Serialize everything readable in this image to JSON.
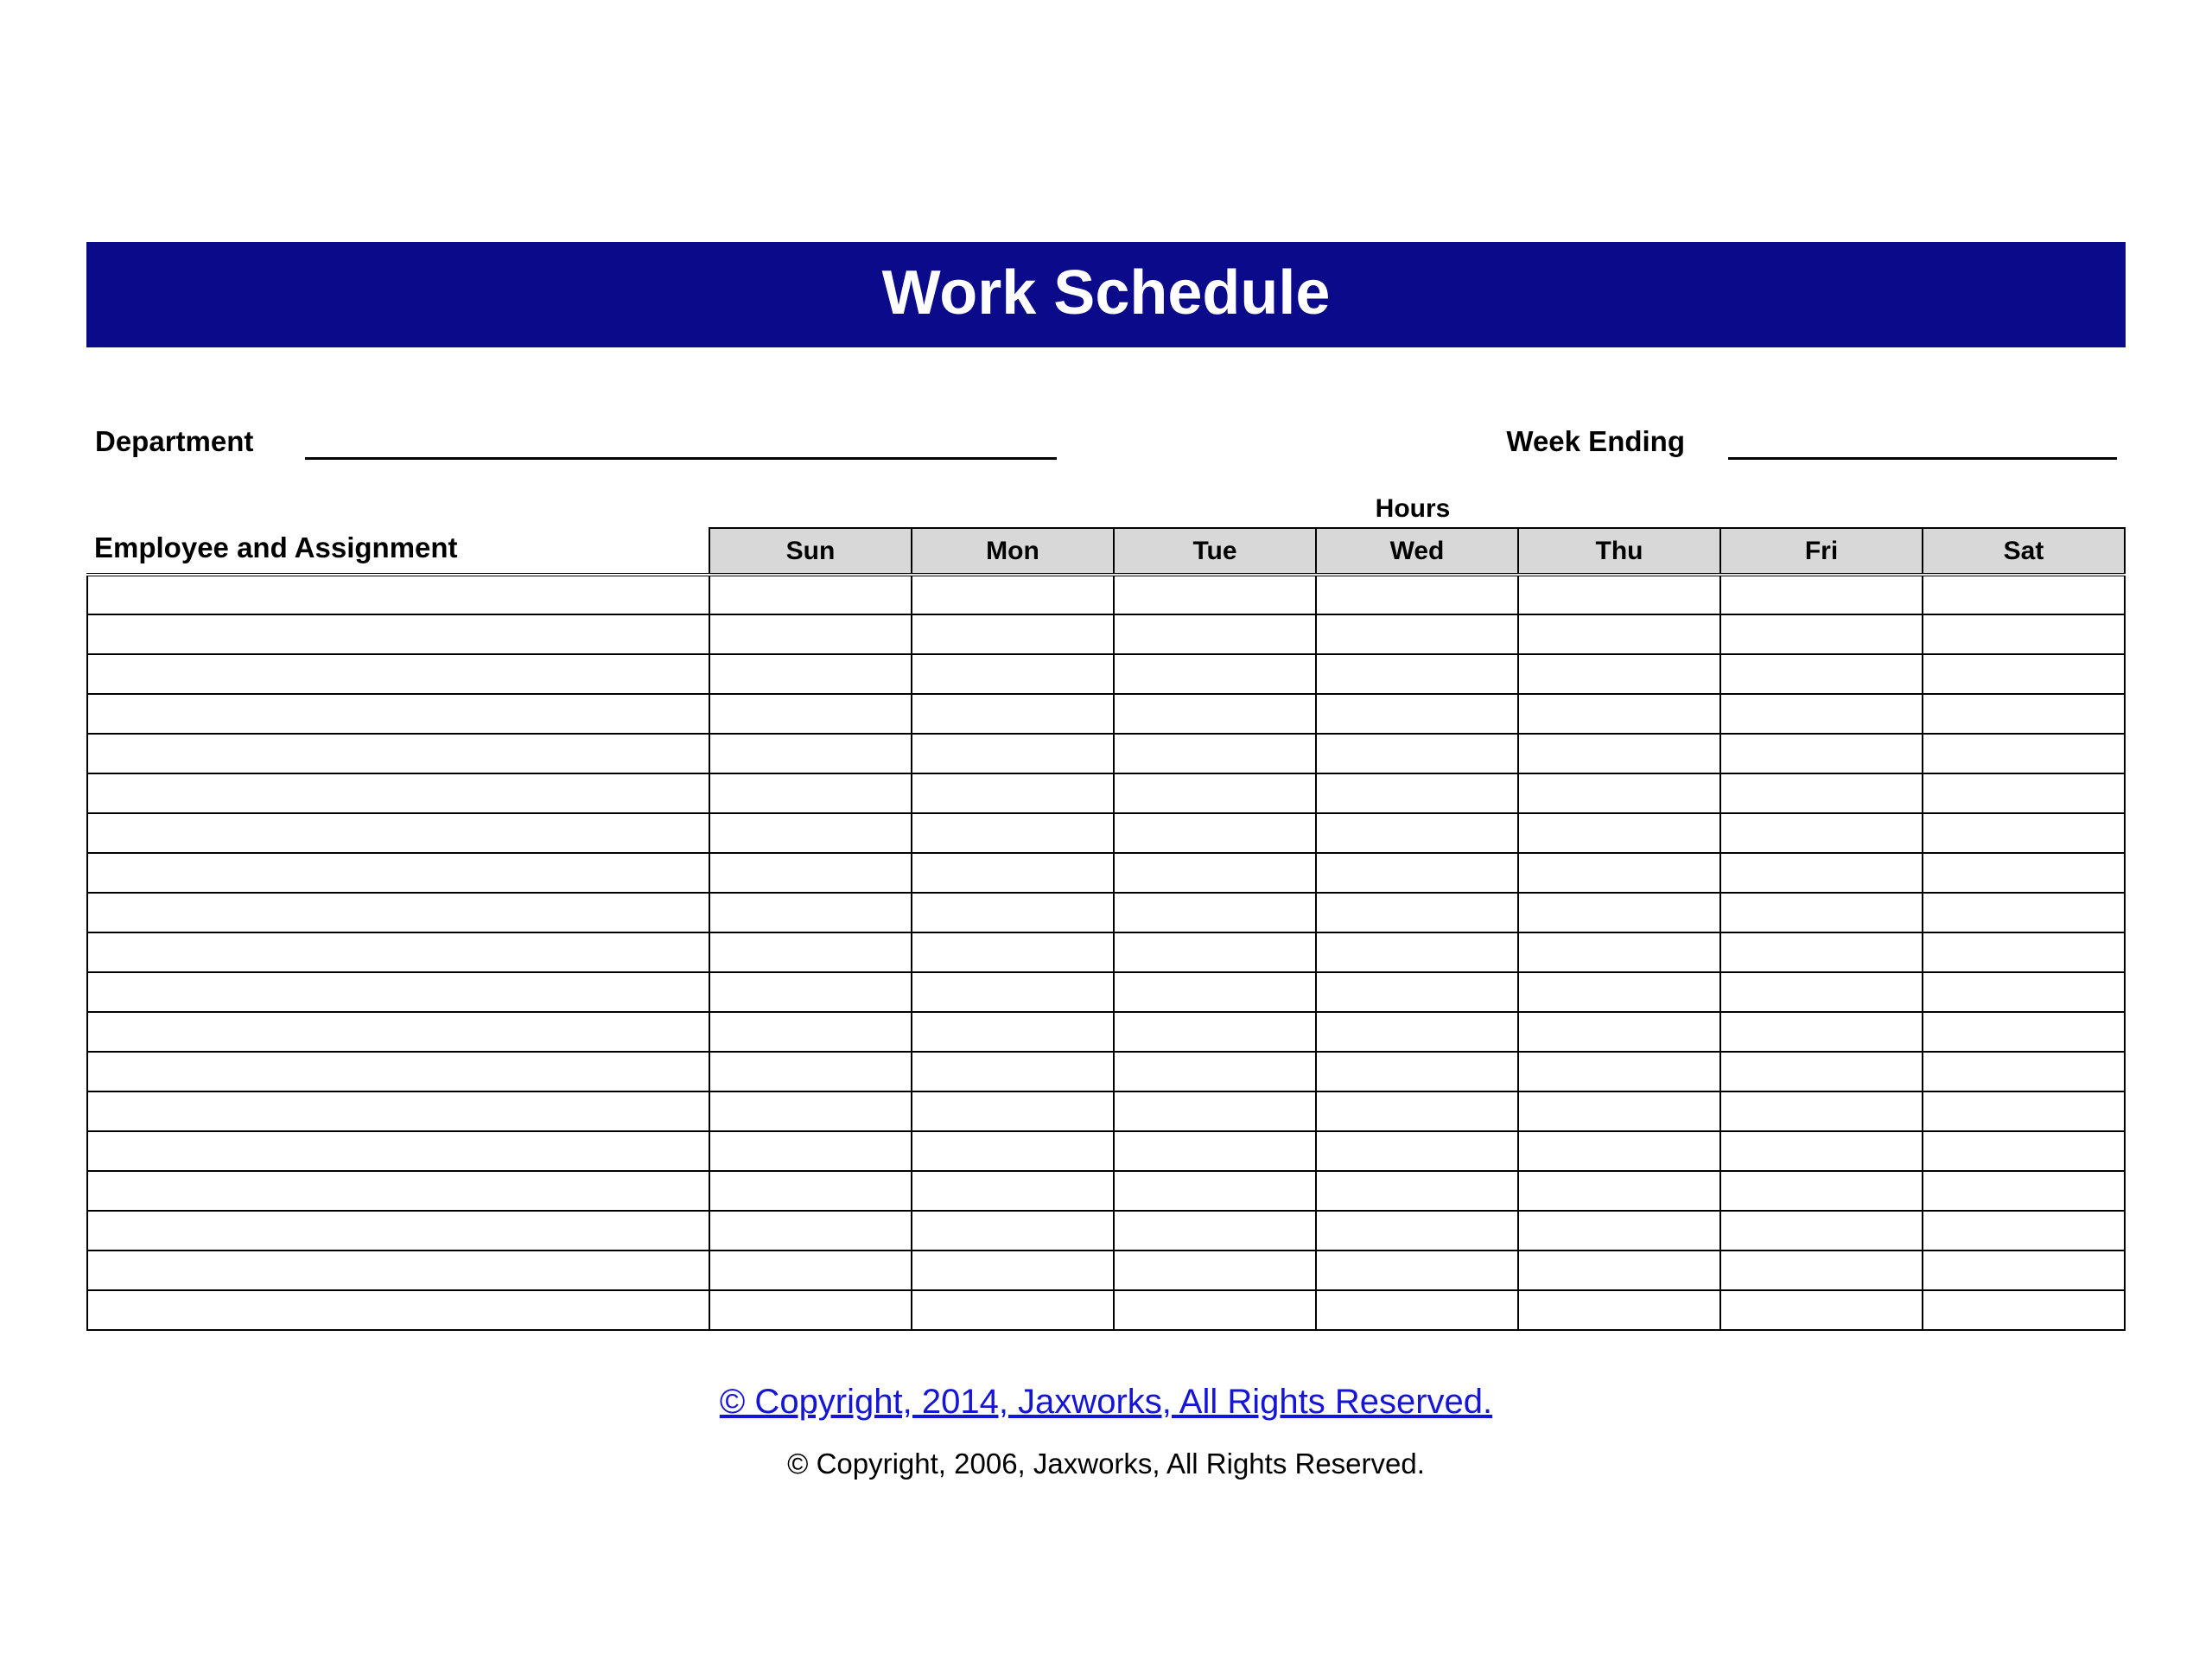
{
  "title": "Work Schedule",
  "meta": {
    "department_label": "Department",
    "week_ending_label": "Week Ending",
    "department_value": "",
    "week_ending_value": ""
  },
  "table": {
    "hours_label": "Hours",
    "employee_header": "Employee and Assignment",
    "days": [
      "Sun",
      "Mon",
      "Tue",
      "Wed",
      "Thu",
      "Fri",
      "Sat"
    ],
    "row_count": 19
  },
  "footer": {
    "link_text": "© Copyright, 2014, Jaxworks, All Rights Reserved.",
    "sub_text": "© Copyright, 2006, Jaxworks, All Rights Reserved."
  }
}
